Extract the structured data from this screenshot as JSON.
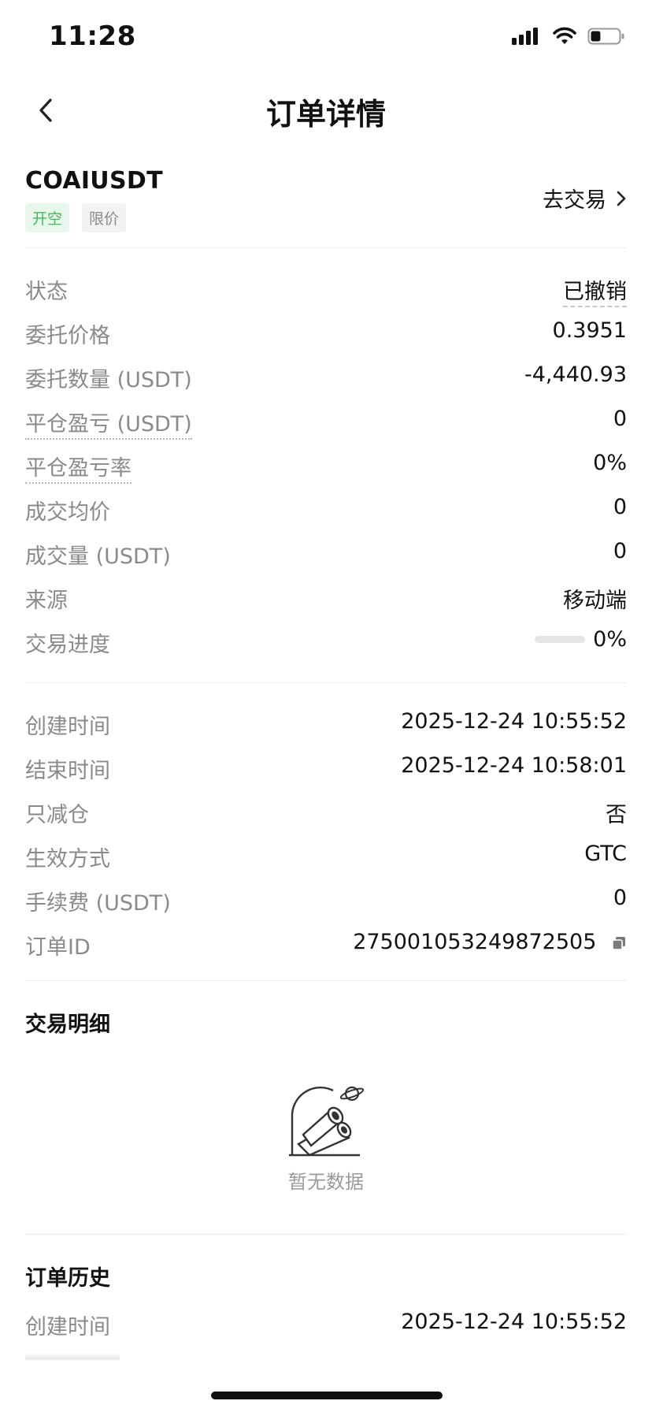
{
  "status_bar": {
    "time": "11:28",
    "battery_level": 0.35
  },
  "nav": {
    "title": "订单详情",
    "back_icon": "chevron-left-icon"
  },
  "pair": {
    "name": "COAIUSDT",
    "tags": [
      "开空",
      "限价"
    ],
    "trade_link": "去交易",
    "colors": {
      "tag_green": "#43b95b",
      "tag_green_bg": "#e8f7ec"
    }
  },
  "details": [
    {
      "label": "状态",
      "value": "已撤销"
    },
    {
      "label": "委托价格",
      "value": "0.3951"
    },
    {
      "label": "委托数量 (USDT)",
      "value": "-4,440.93"
    },
    {
      "label": "平仓盈亏 (USDT)",
      "value": "0"
    },
    {
      "label": "平仓盈亏率",
      "value": "0%"
    },
    {
      "label": "成交均价",
      "value": "0"
    },
    {
      "label": "成交量 (USDT)",
      "value": "0"
    },
    {
      "label": "来源",
      "value": "移动端"
    },
    {
      "label": "交易进度",
      "value": "0%",
      "progress": 0
    }
  ],
  "meta": [
    {
      "label": "创建时间",
      "value": "2025-12-24 10:55:52"
    },
    {
      "label": "结束时间",
      "value": "2025-12-24 10:58:01"
    },
    {
      "label": "只减仓",
      "value": "否"
    },
    {
      "label": "生效方式",
      "value": "GTC"
    },
    {
      "label": "手续费 (USDT)",
      "value": "0"
    },
    {
      "label": "订单ID",
      "value": "275001053249872505"
    }
  ],
  "trade_details": {
    "title": "交易明细",
    "empty_text": "暂无数据"
  },
  "order_history": {
    "title": "订单历史",
    "rows": [
      {
        "label": "创建时间",
        "value": "2025-12-24 10:55:52"
      }
    ]
  }
}
